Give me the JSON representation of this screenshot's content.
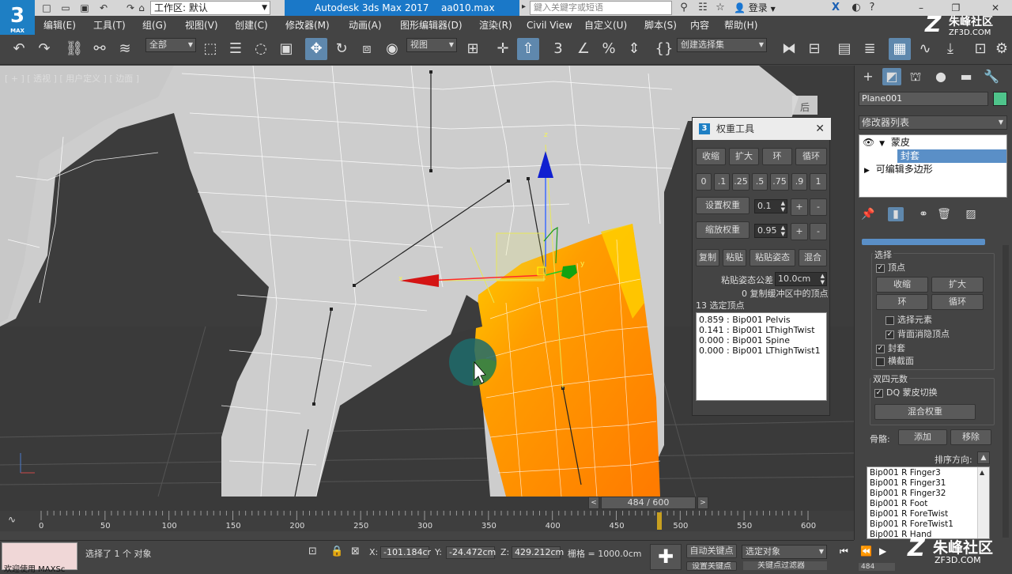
{
  "titlebar": {
    "workspace_label": "工作区: 默认",
    "app_name": "Autodesk 3ds Max 2017",
    "file_name": "aa010.max",
    "search_placeholder": "鍵入关鍵字或短语",
    "login_label": "登录",
    "help_label": "?"
  },
  "logo": {
    "text": "3",
    "sub": "MAX"
  },
  "brand": {
    "name": "朱峰社区",
    "url": "ZF3D.COM"
  },
  "menubar": {
    "items": [
      "编辑(E)",
      "工具(T)",
      "组(G)",
      "视图(V)",
      "创建(C)",
      "修改器(M)",
      "动画(A)",
      "图形编辑器(D)",
      "渲染(R)",
      "Civil View",
      "自定义(U)",
      "脚本(S)",
      "内容",
      "帮助(H)"
    ]
  },
  "toolbar": {
    "filter_label": "全部",
    "refcoord_label": "视图",
    "selection_set_label": "创建选择集",
    "snap_label": "3"
  },
  "viewport": {
    "label": "[ + ] [ 透视 ] [ 用户定义 ] [ 边面 ]",
    "viewcube_label": "后",
    "gizmo_labels": {
      "x": "x",
      "y": "y",
      "z": "z"
    }
  },
  "weight_tool": {
    "title": "权重工具",
    "buttons_row1": [
      "收缩",
      "扩大",
      "环",
      "循环"
    ],
    "buttons_row2": [
      "0",
      ".1",
      ".25",
      ".5",
      ".75",
      ".9",
      "1"
    ],
    "set_weight_label": "设置权重",
    "set_weight_value": "0.1",
    "scale_weight_label": "缩放权重",
    "scale_weight_value": "0.95",
    "plus": "+",
    "minus": "-",
    "buttons_row3": [
      "复制",
      "粘贴",
      "粘贴姿态",
      "混合"
    ],
    "paste_tolerance_label": "粘贴姿态公差",
    "paste_tolerance_value": "10.0cm",
    "buffer_info": "0 复制缓冲区中的顶点",
    "selected_count": "13 选定顶点",
    "weights": [
      "0.859 : Bip001 Pelvis",
      "0.141 : Bip001 LThighTwist",
      "0.000 : Bip001 Spine",
      "0.000 : Bip001 LThighTwist1"
    ]
  },
  "command_panel": {
    "object_name": "Plane001",
    "object_color": "#4fc48b",
    "modifier_list_label": "修改器列表",
    "stack": [
      {
        "label": "蒙皮",
        "prefix": "▼"
      },
      {
        "label": "封套",
        "prefix": ""
      },
      {
        "label": "可编辑多边形",
        "prefix": "▶"
      }
    ],
    "select_group_label": "选择",
    "vertex_check": "顶点",
    "shrink": "收缩",
    "grow": "扩大",
    "ring": "环",
    "loop": "循环",
    "select_element": "选择元素",
    "backface_cull": "背面消隐顶点",
    "envelopes": "封套",
    "cross_sections": "横截面",
    "dq_group_label": "双四元数",
    "dq_toggle": "DQ 蒙皮切换",
    "blend_weights": "混合权重",
    "bones_label": "骨骼:",
    "add": "添加",
    "remove": "移除",
    "sort_label": "排序方向:",
    "bones": [
      "Bip001 R Finger3",
      "Bip001 R Finger31",
      "Bip001 R Finger32",
      "Bip001 R Foot",
      "Bip001 R ForeTwist",
      "Bip001 R ForeTwist1",
      "Bip001 R Hand"
    ]
  },
  "timeline": {
    "frame_display": "484 / 600",
    "current_frame": 484,
    "max_frame": 600,
    "ticks": [
      "0",
      "50",
      "100",
      "150",
      "200",
      "250",
      "300",
      "350",
      "400",
      "450",
      "500",
      "550",
      "600"
    ]
  },
  "status": {
    "maxscript_text": "欢迎使用 MAXSc",
    "message": "选择了 1 个 对象",
    "x_label": "X:",
    "x_value": "-101.184cr",
    "y_label": "Y:",
    "y_value": "-24.472cm",
    "z_label": "Z:",
    "z_value": "429.212cm",
    "grid_label": "栅格 = 1000.0cm",
    "autokey_label": "自动关键点",
    "setkey_label": "设置关键点",
    "selected_label": "选定对象",
    "keyfilter_label": "关键点过滤器",
    "frame_field": "484"
  }
}
